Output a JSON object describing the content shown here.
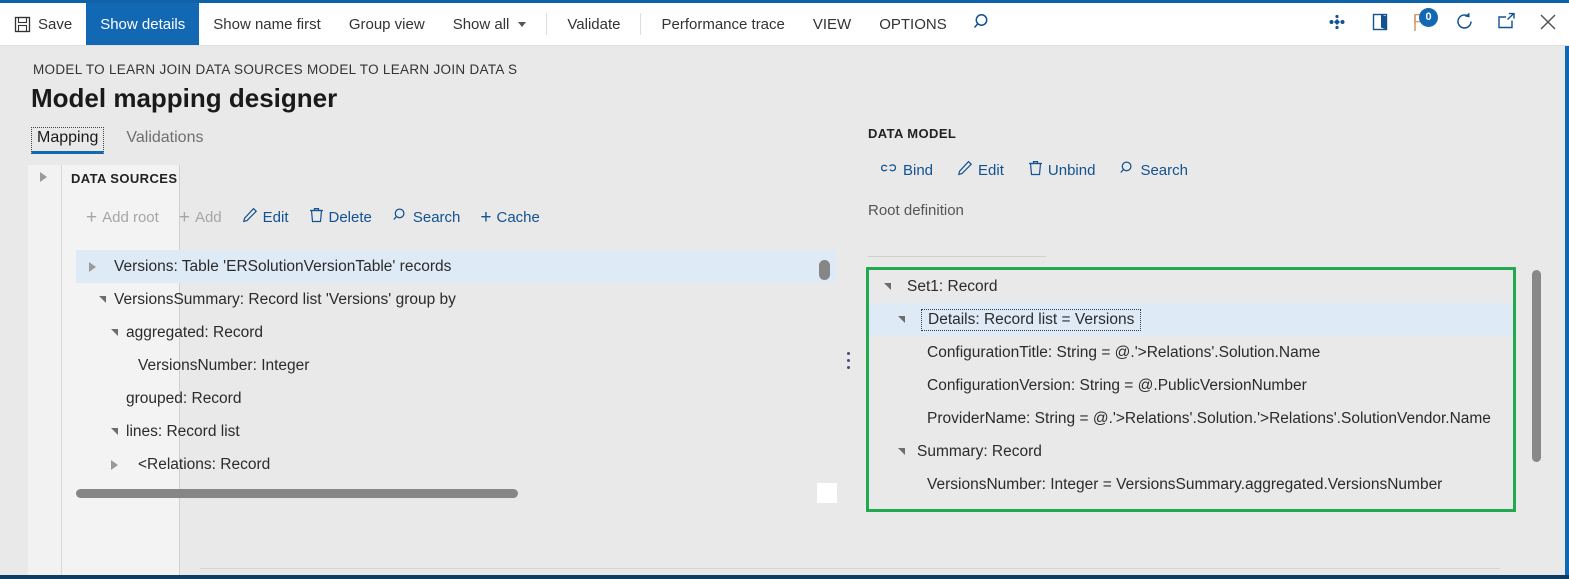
{
  "toolbar": {
    "items": [
      {
        "label": "Save",
        "icon": "save-icon",
        "state": "normal"
      },
      {
        "label": "Show details",
        "icon": "",
        "state": "active"
      },
      {
        "label": "Show name first",
        "icon": "",
        "state": "normal"
      },
      {
        "label": "Group view",
        "icon": "",
        "state": "normal"
      },
      {
        "label": "Show all",
        "icon": "chevron-down-icon",
        "state": "normal"
      },
      {
        "label": "Validate",
        "icon": "",
        "state": "normal"
      },
      {
        "label": "Performance trace",
        "icon": "",
        "state": "normal"
      },
      {
        "label": "VIEW",
        "icon": "",
        "state": "normal"
      },
      {
        "label": "OPTIONS",
        "icon": "",
        "state": "normal"
      }
    ],
    "search_icon": "search-icon",
    "right_icons": [
      {
        "name": "company-settings-icon"
      },
      {
        "name": "help-panel-icon"
      },
      {
        "name": "notifications-flag-icon",
        "badge": "0"
      },
      {
        "name": "refresh-icon"
      },
      {
        "name": "popout-icon"
      },
      {
        "name": "close-icon"
      }
    ],
    "accent_color": "#1268b3",
    "link_color": "#11528f"
  },
  "header": {
    "breadcrumb": "MODEL TO LEARN JOIN DATA SOURCES MODEL TO LEARN JOIN DATA S",
    "title": "Model mapping designer"
  },
  "tabs": [
    {
      "label": "Mapping",
      "selected": true
    },
    {
      "label": "Validations",
      "selected": false
    }
  ],
  "data_sources": {
    "section_title": "DATA SOURCES",
    "expander": "chevron-right-icon",
    "commands": [
      {
        "label": "Add root",
        "icon": "plus-icon",
        "disabled": true
      },
      {
        "label": "Add",
        "icon": "plus-icon",
        "disabled": true
      },
      {
        "label": "Edit",
        "icon": "pencil-icon",
        "disabled": false
      },
      {
        "label": "Delete",
        "icon": "trash-icon",
        "disabled": false
      },
      {
        "label": "Search",
        "icon": "search-icon",
        "disabled": false
      },
      {
        "label": "Cache",
        "icon": "plus-icon",
        "disabled": false
      }
    ],
    "tree": [
      {
        "label": "Versions: Table 'ERSolutionVersionTable' records",
        "indent": 0,
        "expander": "collapsed",
        "selected": true
      },
      {
        "label": "VersionsSummary: Record list 'Versions' group by",
        "indent": 0,
        "expander": "expanded",
        "selected": false
      },
      {
        "label": "aggregated: Record",
        "indent": 1,
        "expander": "expanded",
        "selected": false
      },
      {
        "label": "VersionsNumber: Integer",
        "indent": 2,
        "expander": "none",
        "selected": false
      },
      {
        "label": "grouped: Record",
        "indent": 1,
        "expander": "none",
        "selected": false
      },
      {
        "label": "lines: Record list",
        "indent": 1,
        "expander": "expanded",
        "selected": false
      },
      {
        "label": "<Relations: Record",
        "indent": 2,
        "expander": "collapsed",
        "selected": false
      }
    ]
  },
  "data_model": {
    "section_title": "DATA MODEL",
    "commands": [
      {
        "label": "Bind",
        "icon": "link-icon",
        "disabled": false
      },
      {
        "label": "Edit",
        "icon": "pencil-icon",
        "disabled": false
      },
      {
        "label": "Unbind",
        "icon": "trash-icon",
        "disabled": false
      },
      {
        "label": "Search",
        "icon": "search-icon",
        "disabled": false
      }
    ],
    "root_definition_label": "Root definition",
    "highlight_color": "#22a94f",
    "tree": [
      {
        "label": "Set1: Record",
        "indent": 0,
        "expander": "expanded",
        "selected": false,
        "focused": false
      },
      {
        "label": "Details: Record list = Versions",
        "indent": 1,
        "expander": "expanded",
        "selected": true,
        "focused": true
      },
      {
        "label": "ConfigurationTitle: String = @.'>Relations'.Solution.Name",
        "indent": 2,
        "expander": "none",
        "selected": false,
        "focused": false
      },
      {
        "label": "ConfigurationVersion: String = @.PublicVersionNumber",
        "indent": 2,
        "expander": "none",
        "selected": false,
        "focused": false
      },
      {
        "label": "ProviderName: String = @.'>Relations'.Solution.'>Relations'.SolutionVendor.Name",
        "indent": 2,
        "expander": "none",
        "selected": false,
        "focused": false
      },
      {
        "label": "Summary: Record",
        "indent": 1,
        "expander": "expanded",
        "selected": false,
        "focused": false
      },
      {
        "label": "VersionsNumber: Integer = VersionsSummary.aggregated.VersionsNumber",
        "indent": 2,
        "expander": "none",
        "selected": false,
        "focused": false
      }
    ]
  },
  "scrollbars": {
    "left_horizontal": true,
    "left_vertical": true,
    "right_vertical": true
  }
}
